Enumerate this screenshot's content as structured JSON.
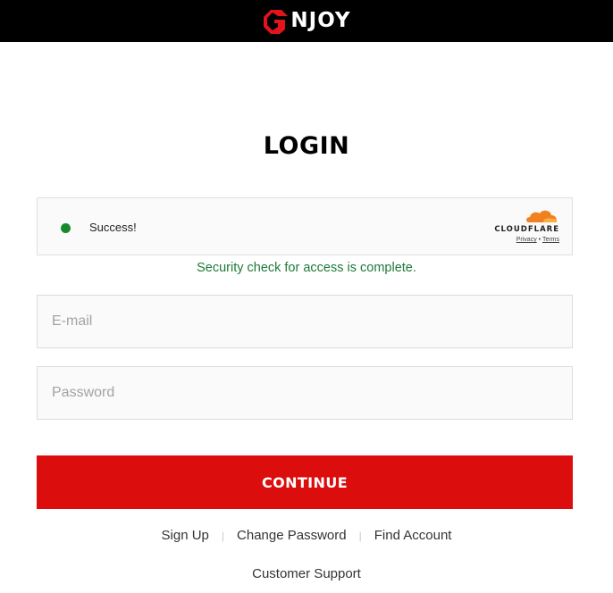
{
  "header": {
    "logo_text": "NJOY",
    "logo_color": "#e3131b"
  },
  "page": {
    "title": "LOGIN"
  },
  "captcha": {
    "status": "Success!",
    "provider": "CLOUDFLARE",
    "privacy_label": "Privacy",
    "separator": "•",
    "terms_label": "Terms",
    "dot_color": "#168a2b"
  },
  "security_message": "Security check for access is complete.",
  "form": {
    "email_placeholder": "E-mail",
    "email_value": "",
    "password_placeholder": "Password",
    "password_value": "",
    "continue_label": "CONTINUE",
    "button_color": "#dc0d0d"
  },
  "links": {
    "sign_up": "Sign Up",
    "change_password": "Change Password",
    "find_account": "Find Account",
    "separator": "|",
    "customer_support": "Customer Support"
  }
}
